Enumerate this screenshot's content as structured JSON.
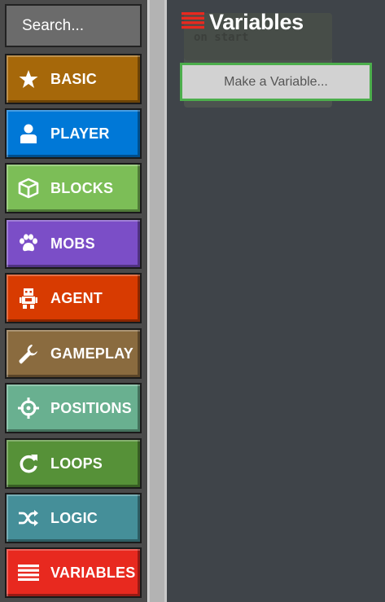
{
  "search": {
    "placeholder": "Search..."
  },
  "categories": [
    {
      "label": "BASIC",
      "icon": "star-icon",
      "color": "#a6680a"
    },
    {
      "label": "PLAYER",
      "icon": "person-icon",
      "color": "#0078d7"
    },
    {
      "label": "BLOCKS",
      "icon": "cube-icon",
      "color": "#7cbe57"
    },
    {
      "label": "MOBS",
      "icon": "paw-icon",
      "color": "#7b4ec7"
    },
    {
      "label": "AGENT",
      "icon": "robot-icon",
      "color": "#d83b01"
    },
    {
      "label": "GAMEPLAY",
      "icon": "wrench-icon",
      "color": "#8a6b3f"
    },
    {
      "label": "POSITIONS",
      "icon": "crosshair-icon",
      "color": "#69b090"
    },
    {
      "label": "LOOPS",
      "icon": "loop-arrow-icon",
      "color": "#569138"
    },
    {
      "label": "LOGIC",
      "icon": "shuffle-icon",
      "color": "#458f99"
    },
    {
      "label": "VARIABLES",
      "icon": "list-lines-icon",
      "color": "#e8291f"
    }
  ],
  "flyout": {
    "title": "Variables",
    "title_icon": "list-lines-icon",
    "title_icon_color": "#e8291f",
    "make_variable_label": "Make a Variable...",
    "background_block_text": "on start"
  }
}
